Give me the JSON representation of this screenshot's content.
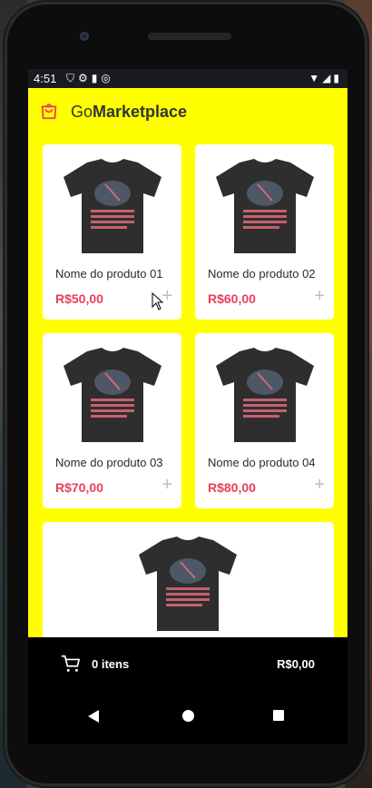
{
  "status_bar": {
    "time": "4:51",
    "left_icons": [
      "shield-icon",
      "gear-icon",
      "sd-card-icon",
      "at-sign-icon"
    ],
    "left_icons_glyph": "⛉⚙▮◎",
    "right_icons": [
      "wifi-icon",
      "signal-icon",
      "battery-icon"
    ],
    "right_icons_glyph": "▼◢▮"
  },
  "header": {
    "brand_prefix": "Go",
    "brand_suffix": "Marketplace",
    "accent_color": "#ffff00"
  },
  "products": [
    {
      "name": "Nome do produto 01",
      "price": "R$50,00",
      "add": "+"
    },
    {
      "name": "Nome do produto 02",
      "price": "R$60,00",
      "add": "+"
    },
    {
      "name": "Nome do produto 03",
      "price": "R$70,00",
      "add": "+"
    },
    {
      "name": "Nome do produto 04",
      "price": "R$80,00",
      "add": "+"
    }
  ],
  "footer": {
    "items_label": "0 itens",
    "total": "R$0,00"
  },
  "colors": {
    "price": "#e83f5b",
    "background": "#ffff00"
  }
}
